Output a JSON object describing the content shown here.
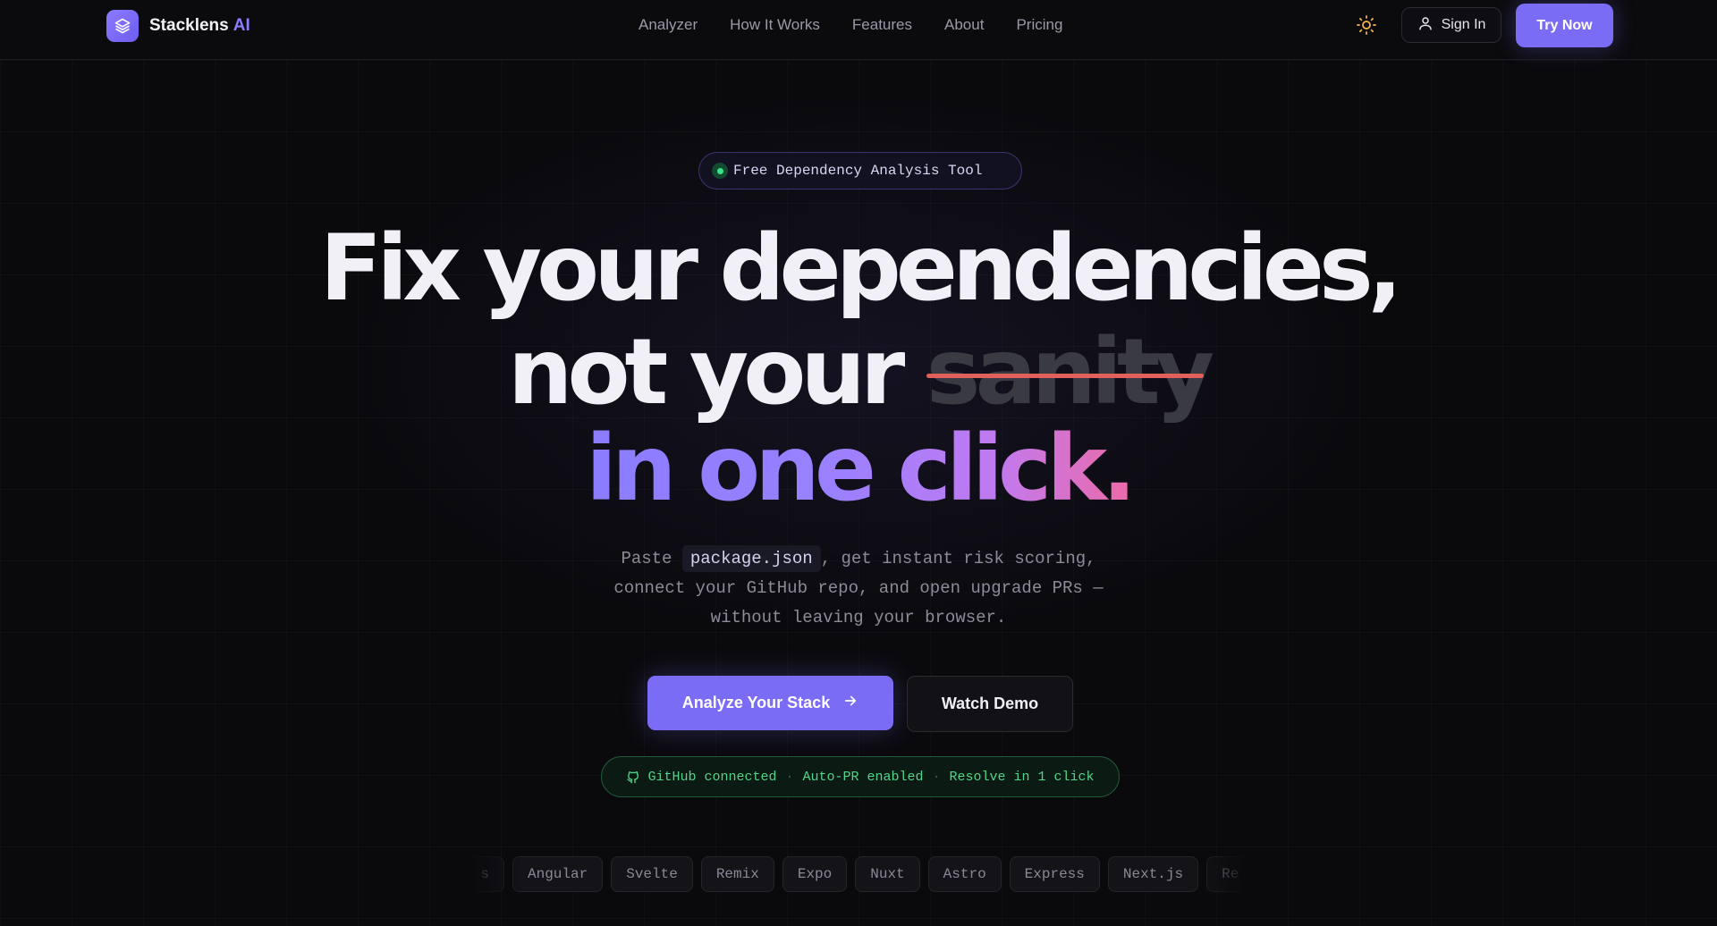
{
  "nav": {
    "brand_name": "Stacklens",
    "brand_suffix": "AI",
    "links": [
      "Analyzer",
      "How It Works",
      "Features",
      "About",
      "Pricing"
    ],
    "sign_in": "Sign In",
    "try_now": "Try Now",
    "theme_icon": "sun-icon"
  },
  "hero": {
    "badge": "Free Dependency Analysis Tool",
    "headline_line1": "Fix your dependencies,",
    "headline_line2_a": "not your ",
    "headline_line2_struck": "sanity",
    "headline_line3": "in one click.",
    "sub_prefix": "Paste",
    "sub_code": "package.json",
    "sub_suffix": ", get instant risk scoring,",
    "sub_line2": "connect your GitHub repo, and open upgrade PRs —",
    "sub_line3": "without leaving your browser.",
    "cta_primary": "Analyze Your Stack",
    "cta_secondary": "Watch Demo"
  },
  "status": {
    "github": "GitHub connected",
    "auto_pr": "Auto-PR enabled",
    "resolve": "Resolve in 1 click"
  },
  "frameworks": {
    "partial_left": "s",
    "items": [
      "Angular",
      "Svelte",
      "Remix",
      "Expo",
      "Nuxt",
      "Astro",
      "Express",
      "Next.js"
    ],
    "partial_right": "Re"
  },
  "colors": {
    "accent": "#7b6cf6",
    "background": "#0a0a0d",
    "status_green": "#4fd68a",
    "strike_red": "#e0605c"
  }
}
